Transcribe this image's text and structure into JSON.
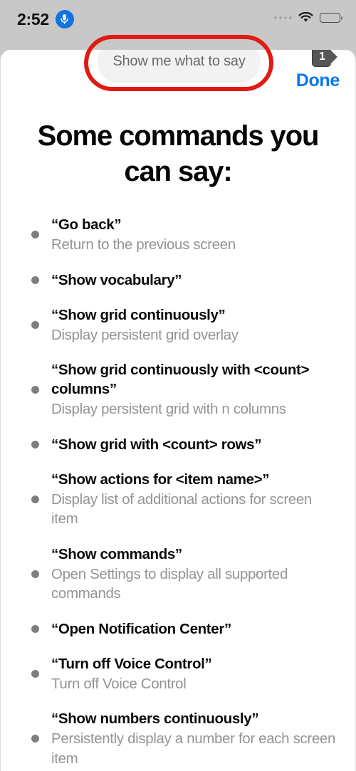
{
  "status_bar": {
    "time": "2:52",
    "mic_icon": "microphone-icon",
    "signal_icon": "signal-dots-icon",
    "wifi_icon": "wifi-icon",
    "battery_icon": "battery-low-icon",
    "battery_level_percent": 33,
    "background_color": "#c8c8c8"
  },
  "top_bar": {
    "say_pill_label": "Show me what to say",
    "number_badge": "1",
    "done_label": "Done",
    "done_color": "#0a76ef"
  },
  "annotation": {
    "shape": "oval",
    "color": "#e01b12",
    "target": "say-pill-button"
  },
  "main": {
    "heading": "Some commands you can say:",
    "commands": [
      {
        "phrase": "“Go back”",
        "description": "Return to the previous screen"
      },
      {
        "phrase": "“Show vocabulary”",
        "description": ""
      },
      {
        "phrase": "“Show grid continuously”",
        "description": "Display persistent grid overlay"
      },
      {
        "phrase": "“Show grid continuously with <count> columns”",
        "description": "Display persistent grid with n columns"
      },
      {
        "phrase": "“Show grid with <count> rows”",
        "description": ""
      },
      {
        "phrase": "“Show actions for <item name>”",
        "description": "Display list of additional actions for screen item"
      },
      {
        "phrase": "“Show commands”",
        "description": "Open Settings to display all supported commands"
      },
      {
        "phrase": "“Open Notification Center”",
        "description": ""
      },
      {
        "phrase": "“Turn off Voice Control”",
        "description": "Turn off Voice Control"
      },
      {
        "phrase": "“Show numbers continuously”",
        "description": "Persistently display a number for each screen item"
      }
    ]
  }
}
